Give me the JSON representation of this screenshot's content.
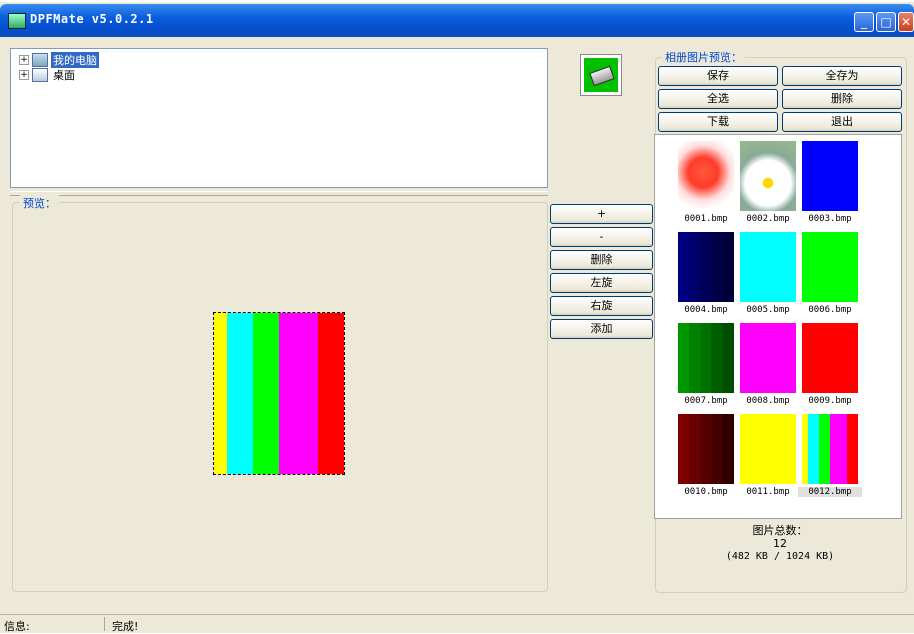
{
  "window": {
    "title": "DPFMate v5.0.2.1"
  },
  "tree": {
    "items": [
      {
        "label": "我的电脑",
        "icon": "computer-icon",
        "selected": true
      },
      {
        "label": "桌面",
        "icon": "desktop-icon",
        "selected": false
      }
    ]
  },
  "preview": {
    "group_label": "预览：",
    "stripe_colors": [
      "#ffff00",
      "#00ffff",
      "#00ff00",
      "#ff00ff",
      "#ff0000"
    ]
  },
  "middle_buttons": {
    "add_label": "+",
    "minus_label": "-",
    "remove_label": "删除",
    "rotate_left_label": "左旋",
    "rotate_right_label": "右旋",
    "append_label": "添加"
  },
  "album": {
    "group_label": "相册图片预览：",
    "save_label": "保存",
    "save_all_label": "全存为",
    "select_all_label": "全选",
    "delete_label": "删除",
    "download_label": "下载",
    "exit_label": "退出",
    "thumbnails": [
      {
        "name": "0001.bmp",
        "kind": "lily-photo"
      },
      {
        "name": "0002.bmp",
        "kind": "daisy-photo"
      },
      {
        "name": "0003.bmp",
        "color": "#0000ff"
      },
      {
        "name": "0004.bmp",
        "kind": "navy-bars"
      },
      {
        "name": "0005.bmp",
        "color": "#00ffff"
      },
      {
        "name": "0006.bmp",
        "color": "#00ff00"
      },
      {
        "name": "0007.bmp",
        "kind": "green-bars"
      },
      {
        "name": "0008.bmp",
        "color": "#ff00ff"
      },
      {
        "name": "0009.bmp",
        "color": "#ff0000"
      },
      {
        "name": "0010.bmp",
        "kind": "maroon-bars"
      },
      {
        "name": "0011.bmp",
        "color": "#ffff00"
      },
      {
        "name": "0012.bmp",
        "kind": "color-bars"
      }
    ],
    "total_label": "图片总数：",
    "total_count": "12",
    "total_size": "(482 KB / 1024 KB)"
  },
  "status": {
    "info_label": "信息:",
    "message": "完成!"
  }
}
